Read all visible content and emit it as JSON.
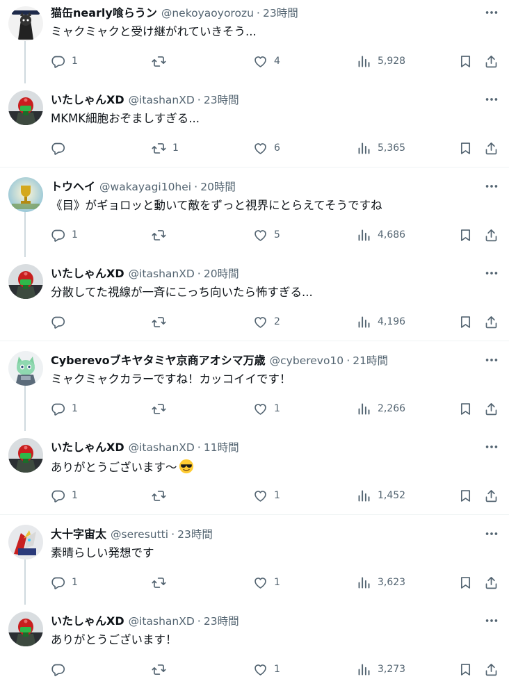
{
  "tweets": [
    {
      "name": "猫缶nearly喰らうン",
      "handle": "@nekoyaoyorozu",
      "sep": "·",
      "time": "23時間",
      "text": "ミャクミャクと受け継がれていきそう...",
      "counts": {
        "reply": "1",
        "retweet": "",
        "like": "4",
        "views": "5,928"
      },
      "avatar": "cat-mascot-avatar"
    },
    {
      "name": "いたしゃんXD",
      "handle": "@itashanXD",
      "sep": "·",
      "time": "23時間",
      "text": "MKMK細胞おぞましすぎる...",
      "counts": {
        "reply": "",
        "retweet": "1",
        "like": "6",
        "views": "5,365"
      },
      "avatar": "robot-avatar"
    },
    {
      "name": "トウヘイ",
      "handle": "@wakayagi10hei",
      "sep": "·",
      "time": "20時間",
      "text": "《目》がギョロッと動いて敵をずっと視界にとらえてそうですね",
      "counts": {
        "reply": "1",
        "retweet": "",
        "like": "5",
        "views": "4,686"
      },
      "avatar": "trophy-avatar"
    },
    {
      "name": "いたしゃんXD",
      "handle": "@itashanXD",
      "sep": "·",
      "time": "20時間",
      "text": "分散してた視線が一斉にこっち向いたら怖すぎる...",
      "counts": {
        "reply": "",
        "retweet": "",
        "like": "2",
        "views": "4,196"
      },
      "avatar": "robot-avatar"
    },
    {
      "name": "Cyberevoブキヤタミヤ京商アオシマ万歳",
      "handle": "@cyberevo10",
      "sep": "·",
      "time": "21時間",
      "text": "ミャクミャクカラーですね！カッコイイです！",
      "counts": {
        "reply": "1",
        "retweet": "",
        "like": "1",
        "views": "2,266"
      },
      "avatar": "mecha-cat-avatar"
    },
    {
      "name": "いたしゃんXD",
      "handle": "@itashanXD",
      "sep": "·",
      "time": "11時間",
      "text": "ありがとうございます〜",
      "counts": {
        "reply": "1",
        "retweet": "",
        "like": "1",
        "views": "1,452"
      },
      "avatar": "robot-avatar",
      "emoji": "sunglasses-emoji"
    },
    {
      "name": "大十字宙太",
      "handle": "@seresutti",
      "sep": "·",
      "time": "23時間",
      "text": "素晴らしい発想です",
      "counts": {
        "reply": "1",
        "retweet": "",
        "like": "1",
        "views": "3,623"
      },
      "avatar": "mecha-avatar"
    },
    {
      "name": "いたしゃんXD",
      "handle": "@itashanXD",
      "sep": "·",
      "time": "23時間",
      "text": "ありがとうございます！",
      "counts": {
        "reply": "",
        "retweet": "",
        "like": "1",
        "views": "3,273"
      },
      "avatar": "robot-avatar"
    }
  ],
  "colors": {
    "text": "#0f1419",
    "secondary": "#536471",
    "divider": "#eff3f4",
    "thread": "#cfd9de"
  }
}
